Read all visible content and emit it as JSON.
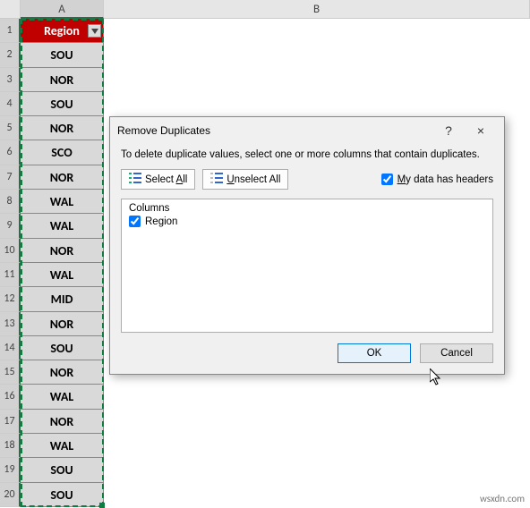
{
  "columns": {
    "a_label": "A",
    "b_label": "B"
  },
  "rows": [
    "1",
    "2",
    "3",
    "4",
    "5",
    "6",
    "7",
    "8",
    "9",
    "10",
    "11",
    "12",
    "13",
    "14",
    "15",
    "16",
    "17",
    "18",
    "19",
    "20"
  ],
  "table": {
    "header": "Region",
    "values": [
      "SOU",
      "NOR",
      "SOU",
      "NOR",
      "SCO",
      "NOR",
      "WAL",
      "WAL",
      "NOR",
      "WAL",
      "MID",
      "NOR",
      "SOU",
      "NOR",
      "WAL",
      "NOR",
      "WAL",
      "SOU",
      "SOU"
    ]
  },
  "dialog": {
    "title": "Remove Duplicates",
    "help_label": "?",
    "close_label": "×",
    "instruction": "To delete duplicate values, select one or more columns that contain duplicates.",
    "select_all_prefix": "Select ",
    "select_all_accel": "A",
    "select_all_suffix": "ll",
    "unselect_all_accel": "U",
    "unselect_all_suffix": "nselect All",
    "headers_checkbox_accel": "M",
    "headers_checkbox_suffix": "y data has headers",
    "columns_label": "Columns",
    "column_items": [
      "Region"
    ],
    "ok_label": "OK",
    "cancel_label": "Cancel"
  },
  "watermark": "wsxdn.com"
}
